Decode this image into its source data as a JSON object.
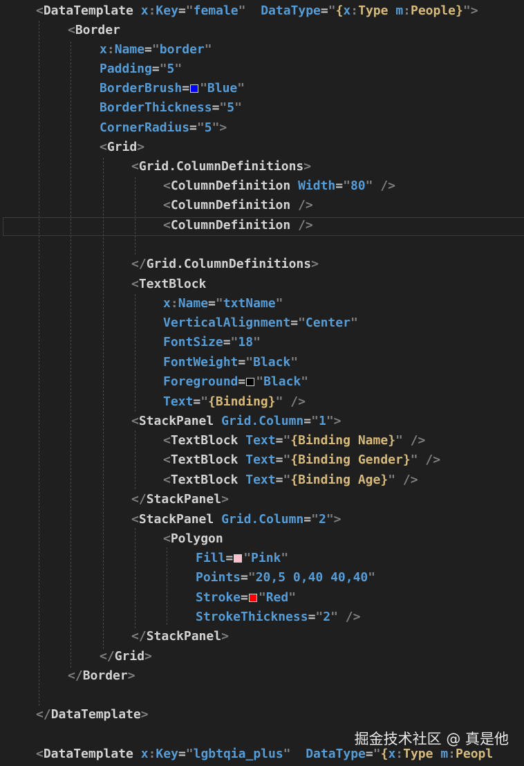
{
  "editor": {
    "language": "XAML",
    "lines": [
      "<DataTemplate x:Key=\"female\"  DataType=\"{x:Type m:People}\">",
      "<Border",
      "x:Name=\"border\"",
      "Padding=\"5\"",
      "BorderBrush=\"Blue\"",
      "BorderThickness=\"5\"",
      "CornerRadius=\"5\">",
      "<Grid>",
      "<Grid.ColumnDefinitions>",
      "<ColumnDefinition Width=\"80\" />",
      "<ColumnDefinition />",
      "<ColumnDefinition />",
      "",
      "</Grid.ColumnDefinitions>",
      "<TextBlock",
      "x:Name=\"txtName\"",
      "VerticalAlignment=\"Center\"",
      "FontSize=\"18\"",
      "FontWeight=\"Black\"",
      "Foreground=\"Black\"",
      "Text=\"{Binding}\" />",
      "<StackPanel Grid.Column=\"1\">",
      "<TextBlock Text=\"{Binding Name}\" />",
      "<TextBlock Text=\"{Binding Gender}\" />",
      "<TextBlock Text=\"{Binding Age}\" />",
      "</StackPanel>",
      "<StackPanel Grid.Column=\"2\">",
      "<Polygon",
      "Fill=\"Pink\"",
      "Points=\"20,5 0,40 40,40\"",
      "Stroke=\"Red\"",
      "StrokeThickness=\"2\" />",
      "</StackPanel>",
      "</Grid>",
      "</Border>",
      "",
      "</DataTemplate>",
      "",
      "<DataTemplate x:Key=\"lgbtqia_plus\"  DataType=\"{x:Type m:People"
    ],
    "highlighted_line_index": 11,
    "color_swatches": {
      "BorderBrush": "#0000ff",
      "Foreground": "#000000",
      "Fill": "#ffc0cb",
      "Stroke": "#ff0000"
    }
  },
  "watermark": "掘金技术社区 @ 真是他"
}
